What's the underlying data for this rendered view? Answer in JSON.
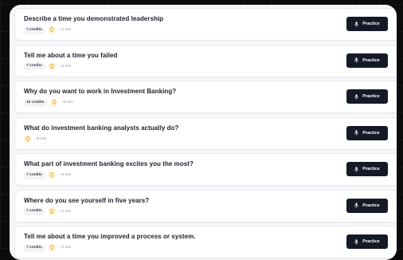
{
  "questions": [
    {
      "title": "Describe a time you demonstrated leadership",
      "credits": "7 credits",
      "duration": "~2 min",
      "button": "Practice"
    },
    {
      "title": "Tell me about a time you failed",
      "credits": "7 credits",
      "duration": "~2 min",
      "button": "Practice"
    },
    {
      "title": "Why do you want to work in Investment Banking?",
      "credits": "10 credits",
      "duration": "~5 min",
      "button": "Practice"
    },
    {
      "title": "What do investment banking analysts actually do?",
      "credits": "",
      "duration": "~5 min",
      "button": "Practice"
    },
    {
      "title": "What part of investment banking excites you the most?",
      "credits": "7 credits",
      "duration": "~2 min",
      "button": "Practice"
    },
    {
      "title": "Where do you see yourself in five years?",
      "credits": "7 credits",
      "duration": "~2 min",
      "button": "Practice"
    },
    {
      "title": "Tell me about a time you improved a process or system.",
      "credits": "7 credits",
      "duration": "~2 min",
      "button": "Practice"
    }
  ],
  "icons": {
    "hint": "lightbulb-icon",
    "practice": "microphone-icon"
  },
  "colors": {
    "button_bg": "#161a27",
    "bulb_bg": "#fff4dc",
    "bulb_fg": "#e0a21c"
  }
}
